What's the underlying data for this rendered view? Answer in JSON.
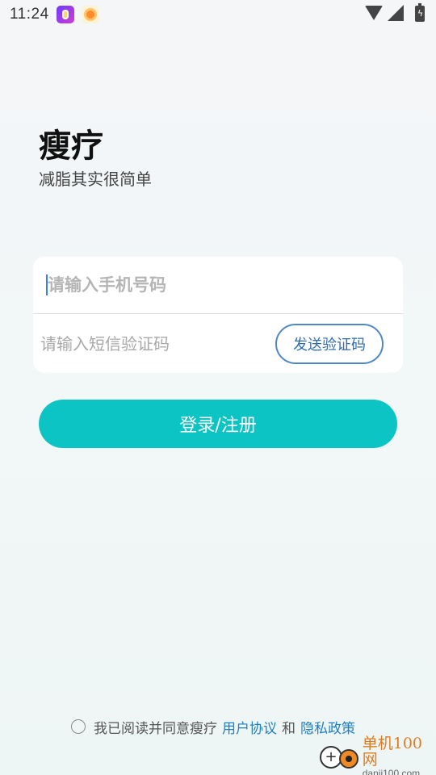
{
  "status_bar": {
    "time": "11:24"
  },
  "app": {
    "title": "瘦疗",
    "subtitle": "减脂其实很简单"
  },
  "form": {
    "phone_placeholder": "请输入手机号码",
    "code_placeholder": "请输入短信验证码",
    "send_code_label": "发送验证码"
  },
  "login_label": "登录/注册",
  "agreement": {
    "prefix": "我已阅读并同意瘦疗",
    "user_agreement": "用户协议",
    "and": "和",
    "privacy_policy": "隐私政策"
  },
  "watermark": {
    "name": "单机100网",
    "domain": "danji100.com"
  },
  "colors": {
    "primary": "#0dc4c4",
    "link": "#1f7fc0",
    "outline_button": "#4f88c6"
  }
}
